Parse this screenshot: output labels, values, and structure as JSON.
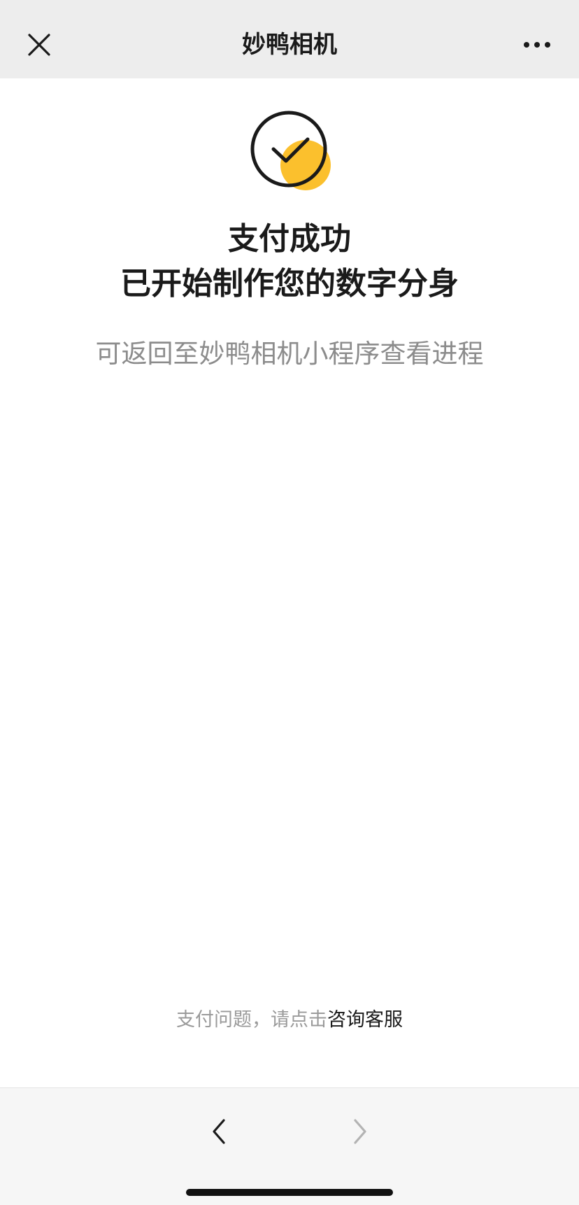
{
  "nav": {
    "title": "妙鸭相机",
    "close_icon": "close-icon",
    "more_icon": "more-dots-icon"
  },
  "status": {
    "icon": "check-circle-icon",
    "icon_accent_color": "#FBC02D",
    "title_line1": "支付成功",
    "title_line2": "已开始制作您的数字分身",
    "subtitle": "可返回至妙鸭相机小程序查看进程"
  },
  "support": {
    "prefix": "支付问题，请点击",
    "link_label": "咨询客服"
  },
  "toolbar": {
    "back_icon": "chevron-left-icon",
    "forward_icon": "chevron-right-icon",
    "forward_enabled": false
  }
}
